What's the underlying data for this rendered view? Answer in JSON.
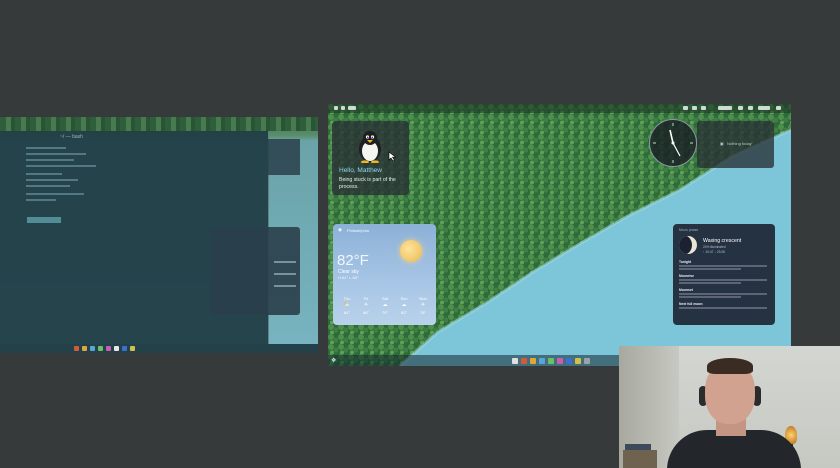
{
  "left_workspace": {
    "window_title": "~/ — bash"
  },
  "right_workspace": {
    "greeting": {
      "name": "Hello, Matthew",
      "quote": "Being stuck is part of the process."
    },
    "calendar": {
      "text": "Nothing today"
    },
    "weather": {
      "location": "Philadelphia",
      "temperature": "82°F",
      "condition": "Clear sky",
      "hi_lo": "H:84° L:68°",
      "forecast": [
        {
          "day": "Thu",
          "icon": "partly-cloudy-icon",
          "temp": "84°"
        },
        {
          "day": "Fri",
          "icon": "sun-icon",
          "temp": "86°"
        },
        {
          "day": "Sat",
          "icon": "cloud-icon",
          "temp": "79°"
        },
        {
          "day": "Sun",
          "icon": "cloud-icon",
          "temp": "82°"
        },
        {
          "day": "Mon",
          "icon": "sun-icon",
          "temp": "78°"
        }
      ]
    },
    "moon": {
      "header": "Moon phase",
      "phase": "Waxing crescent",
      "illumination": "24% illuminated",
      "rise_set": "↑ 10:47  ↓ 23:08",
      "rows": [
        "Tonight",
        "Moonrise",
        "Moonset",
        "Next full moon"
      ]
    }
  },
  "colors": {
    "desktop_bg": "#363a3b",
    "greeting_accent": "#8fd6ee",
    "water": "#7cc3d6",
    "forest": "#2f6b3a"
  }
}
